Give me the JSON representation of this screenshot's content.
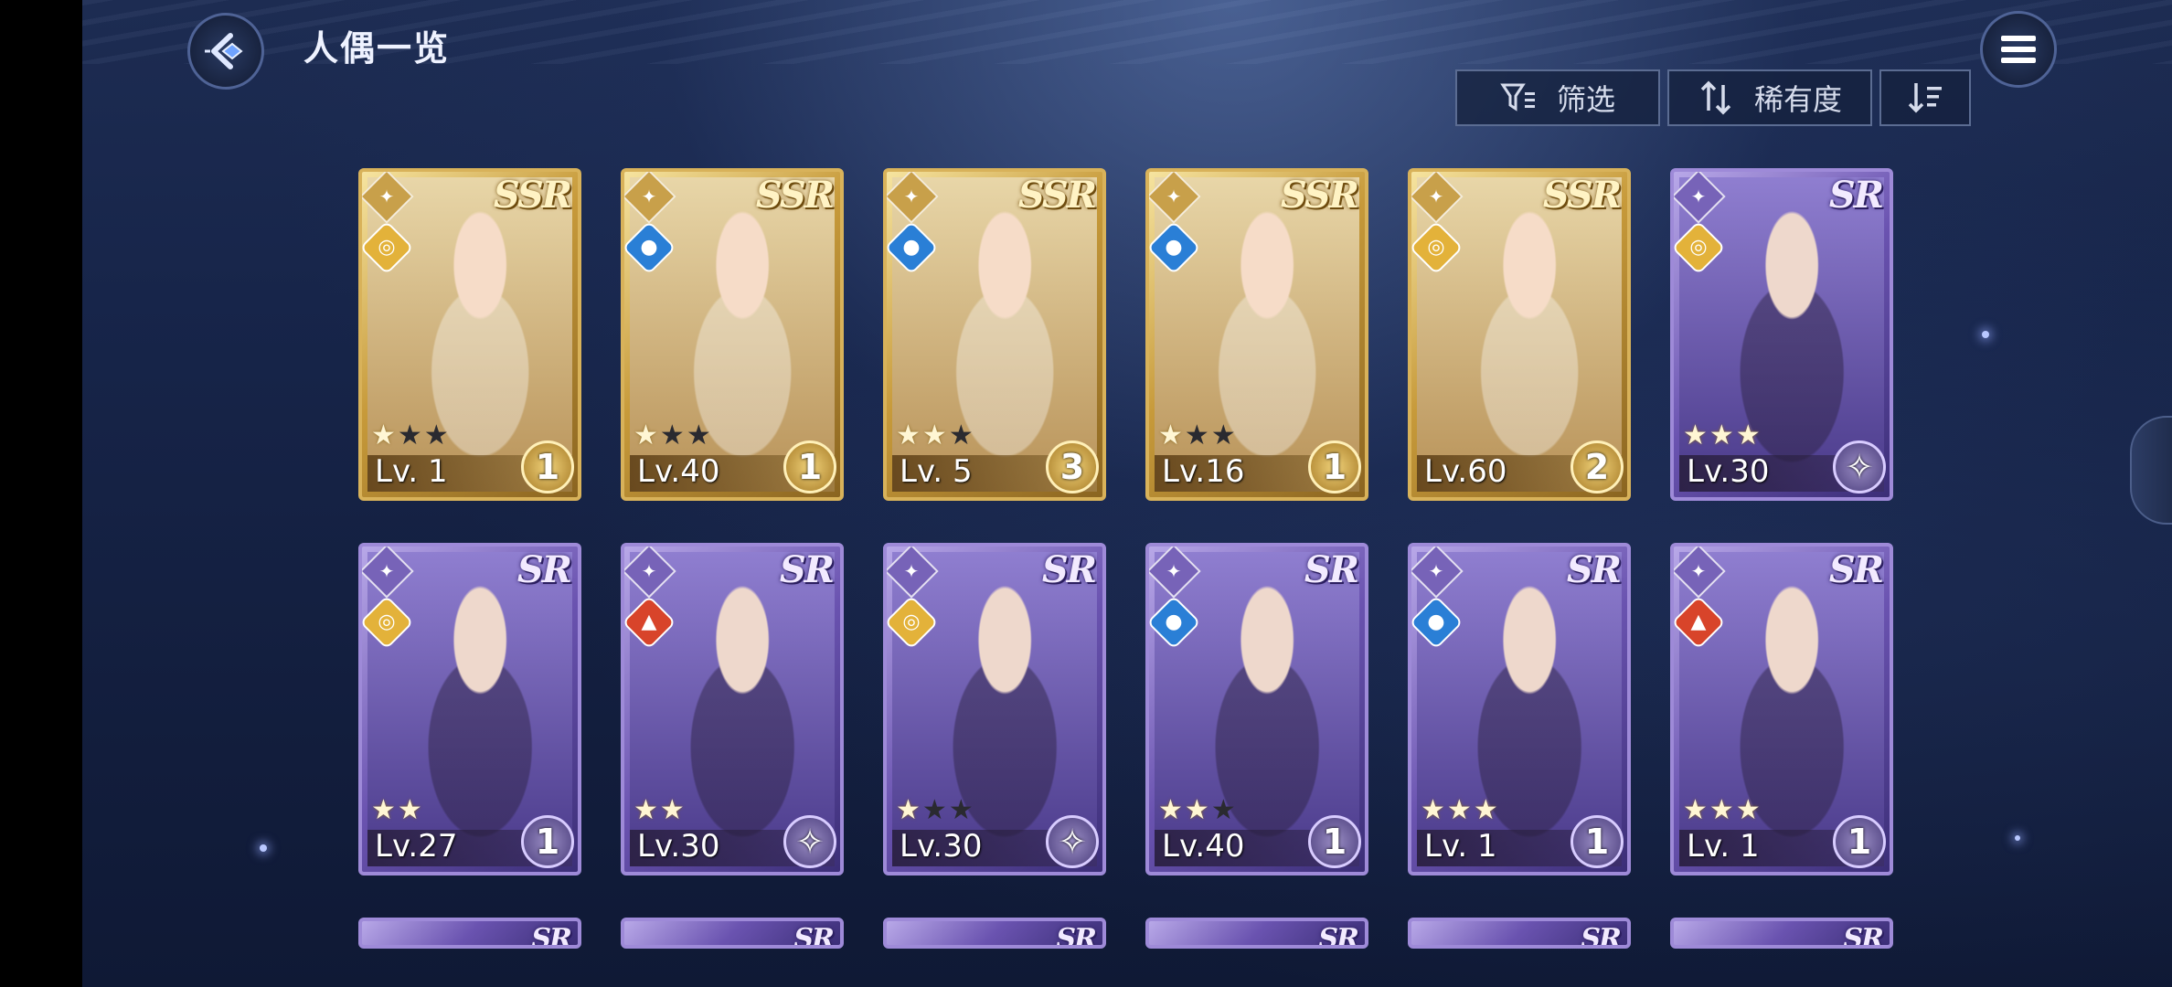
{
  "header": {
    "title": "人偶一览",
    "back_icon": "back-arrow-icon",
    "menu_icon": "menu-icon"
  },
  "toolbar": {
    "filter_label": "筛选",
    "sort_label": "稀有度",
    "filter_icon": "filter-icon",
    "sort_icon": "sort-arrows-icon",
    "order_icon": "sort-order-icon"
  },
  "colors": {
    "ssr_frame": "#d8b25a",
    "sr_frame": "#9e8ad8",
    "background": "#17254a"
  },
  "cards": [
    {
      "rarity": "SSR",
      "level": "Lv. 1",
      "stars_on": 1,
      "stars_off": 2,
      "awakening": "1",
      "element": "light"
    },
    {
      "rarity": "SSR",
      "level": "Lv.40",
      "stars_on": 1,
      "stars_off": 2,
      "awakening": "1",
      "element": "water"
    },
    {
      "rarity": "SSR",
      "level": "Lv. 5",
      "stars_on": 2,
      "stars_off": 1,
      "awakening": "3",
      "element": "water"
    },
    {
      "rarity": "SSR",
      "level": "Lv.16",
      "stars_on": 1,
      "stars_off": 2,
      "awakening": "1",
      "element": "water"
    },
    {
      "rarity": "SSR",
      "level": "Lv.60",
      "stars_on": 0,
      "stars_off": 0,
      "awakening": "2",
      "element": "light"
    },
    {
      "rarity": "SR",
      "level": "Lv.30",
      "stars_on": 3,
      "stars_off": 0,
      "awakening": "",
      "element": "light"
    },
    {
      "rarity": "SR",
      "level": "Lv.27",
      "stars_on": 2,
      "stars_off": 0,
      "awakening": "1",
      "element": "light"
    },
    {
      "rarity": "SR",
      "level": "Lv.30",
      "stars_on": 2,
      "stars_off": 0,
      "awakening": "",
      "element": "fire"
    },
    {
      "rarity": "SR",
      "level": "Lv.30",
      "stars_on": 1,
      "stars_off": 2,
      "awakening": "",
      "element": "light"
    },
    {
      "rarity": "SR",
      "level": "Lv.40",
      "stars_on": 2,
      "stars_off": 1,
      "awakening": "1",
      "element": "water"
    },
    {
      "rarity": "SR",
      "level": "Lv. 1",
      "stars_on": 3,
      "stars_off": 0,
      "awakening": "1",
      "element": "water"
    },
    {
      "rarity": "SR",
      "level": "Lv. 1",
      "stars_on": 3,
      "stars_off": 0,
      "awakening": "1",
      "element": "fire"
    }
  ],
  "partial_row": [
    {
      "rarity": "SR"
    },
    {
      "rarity": "SR"
    },
    {
      "rarity": "SR"
    },
    {
      "rarity": "SR"
    },
    {
      "rarity": "SR"
    },
    {
      "rarity": "SR"
    }
  ]
}
